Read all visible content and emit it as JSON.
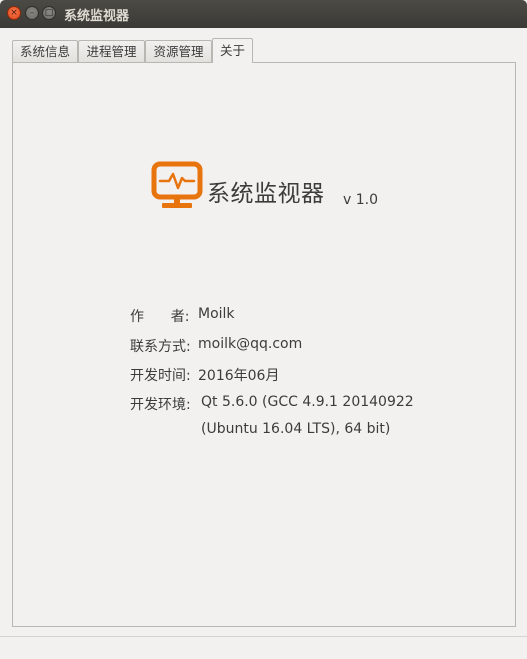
{
  "window": {
    "title": "系统监视器",
    "close_glyph": "×",
    "min_glyph": "–",
    "max_glyph": "□"
  },
  "tabs": [
    {
      "label": "系统信息"
    },
    {
      "label": "进程管理"
    },
    {
      "label": "资源管理"
    },
    {
      "label": "关于"
    }
  ],
  "active_tab": "关于",
  "about": {
    "app_name": "系统监视器",
    "version": "v 1.0",
    "logo_icon": "monitor-pulse-icon",
    "accent_color": "#e8740e",
    "rows": [
      {
        "label": "作      者:",
        "value": "Moilk"
      },
      {
        "label": "联系方式:",
        "value": "moilk@qq.com"
      },
      {
        "label": "开发时间:",
        "value": "2016年06月"
      },
      {
        "label": "开发环境:",
        "value": "Qt 5.6.0 (GCC 4.9.1 20140922"
      }
    ],
    "env_continuation": "(Ubuntu 16.04 LTS), 64 bit)"
  }
}
